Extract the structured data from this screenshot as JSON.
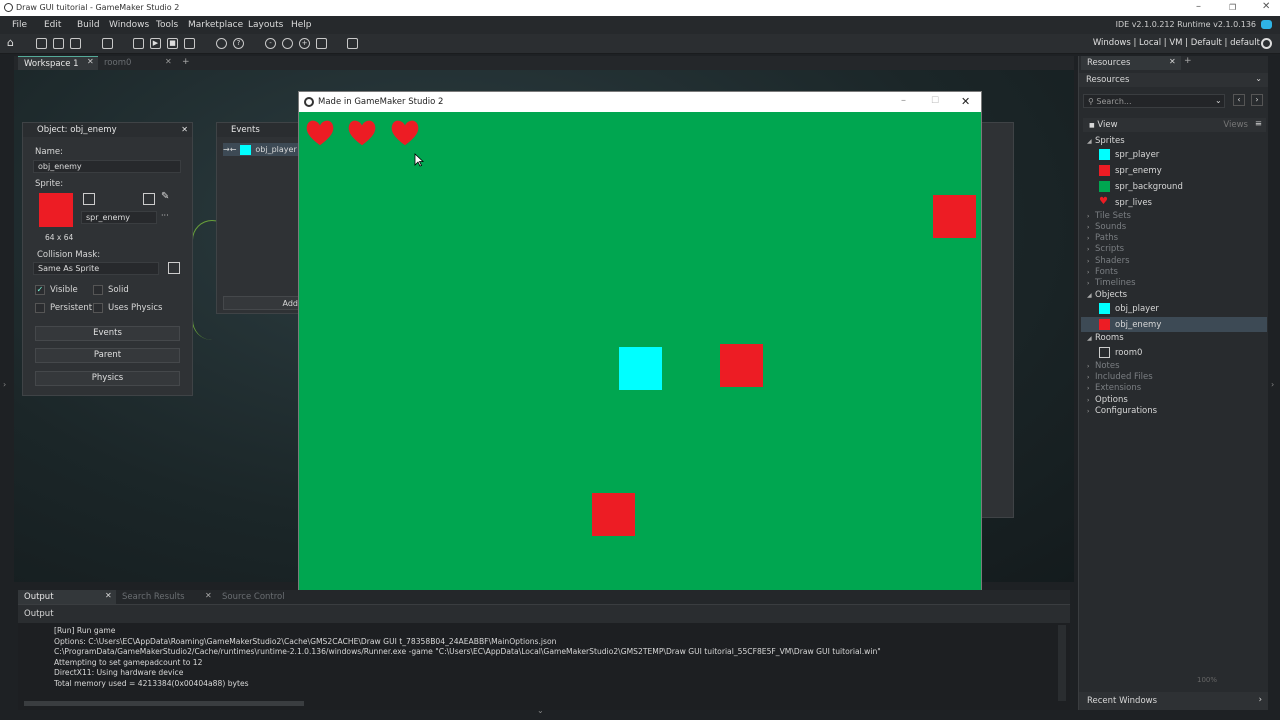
{
  "window_title": "Draw GUI tuitorial - GameMaker Studio 2",
  "menu": [
    "File",
    "Edit",
    "Build",
    "Windows",
    "Tools",
    "Marketplace",
    "Layouts",
    "Help"
  ],
  "ide_version": "IDE v2.1.0.212 Runtime v2.1.0.136",
  "targets": "Windows  |  Local  |  VM  |  Default  |  default",
  "workspace_tabs": [
    "Workspace 1",
    "room0"
  ],
  "object_editor": {
    "title": "Object: obj_enemy",
    "name_label": "Name:",
    "name_value": "obj_enemy",
    "sprite_label": "Sprite:",
    "sprite_value": "spr_enemy",
    "sprite_size": "64 x 64",
    "collision_label": "Collision Mask:",
    "collision_value": "Same As Sprite",
    "visible_label": "Visible",
    "solid_label": "Solid",
    "persistent_label": "Persistent",
    "physics_check_label": "Uses Physics",
    "events_button": "Events",
    "parent_button": "Parent",
    "physics_button": "Physics",
    "colors": {
      "sprite": "#ed1c24"
    }
  },
  "events_panel": {
    "title": "Events",
    "item": "obj_player",
    "add_button": "Add"
  },
  "game_window": {
    "title": "Made in GameMaker Studio 2",
    "lives": 3,
    "colors": {
      "background": "#00a650",
      "enemy": "#ed1c24",
      "player": "#00ffff",
      "heart": "#ed1c24"
    }
  },
  "output": {
    "tabs": [
      "Output",
      "Search Results",
      "Source Control"
    ],
    "header": "Output",
    "lines": [
      "[Run] Run game",
      "Options: C:\\Users\\EC\\AppData\\Roaming\\GameMakerStudio2\\Cache\\GMS2CACHE\\Draw GUI t_78358B04_24AEABBF\\MainOptions.json",
      "C:\\ProgramData/GameMakerStudio2/Cache/runtimes\\runtime-2.1.0.136/windows/Runner.exe -game \"C:\\Users\\EC\\AppData\\Local\\GameMakerStudio2\\GMS2TEMP\\Draw GUI tuitorial_55CF8E5F_VM\\Draw GUI tuitorial.win\"",
      "Attempting to set gamepadcount to 12",
      "DirectX11: Using hardware device",
      "Total memory used = 4213384(0x00404a88) bytes"
    ],
    "zoom": "100%"
  },
  "resources": {
    "tab": "Resources",
    "header": "Resources",
    "search_placeholder": "Search...",
    "view_label": "View",
    "views_label": "Views",
    "groups": {
      "sprites": "Sprites",
      "tile_sets": "Tile Sets",
      "sounds": "Sounds",
      "paths": "Paths",
      "scripts": "Scripts",
      "shaders": "Shaders",
      "fonts": "Fonts",
      "timelines": "Timelines",
      "objects": "Objects",
      "rooms": "Rooms",
      "notes": "Notes",
      "included_files": "Included Files",
      "extensions": "Extensions",
      "options": "Options",
      "configurations": "Configurations"
    },
    "sprites": [
      "spr_player",
      "spr_enemy",
      "spr_background",
      "spr_lives"
    ],
    "objects": [
      "obj_player",
      "obj_enemy"
    ],
    "rooms": [
      "room0"
    ],
    "recent_windows": "Recent Windows",
    "colors": {
      "spr_player": "#00ffff",
      "spr_enemy": "#ed1c24",
      "spr_background": "#00a650",
      "spr_lives": "#ed1c24"
    }
  }
}
